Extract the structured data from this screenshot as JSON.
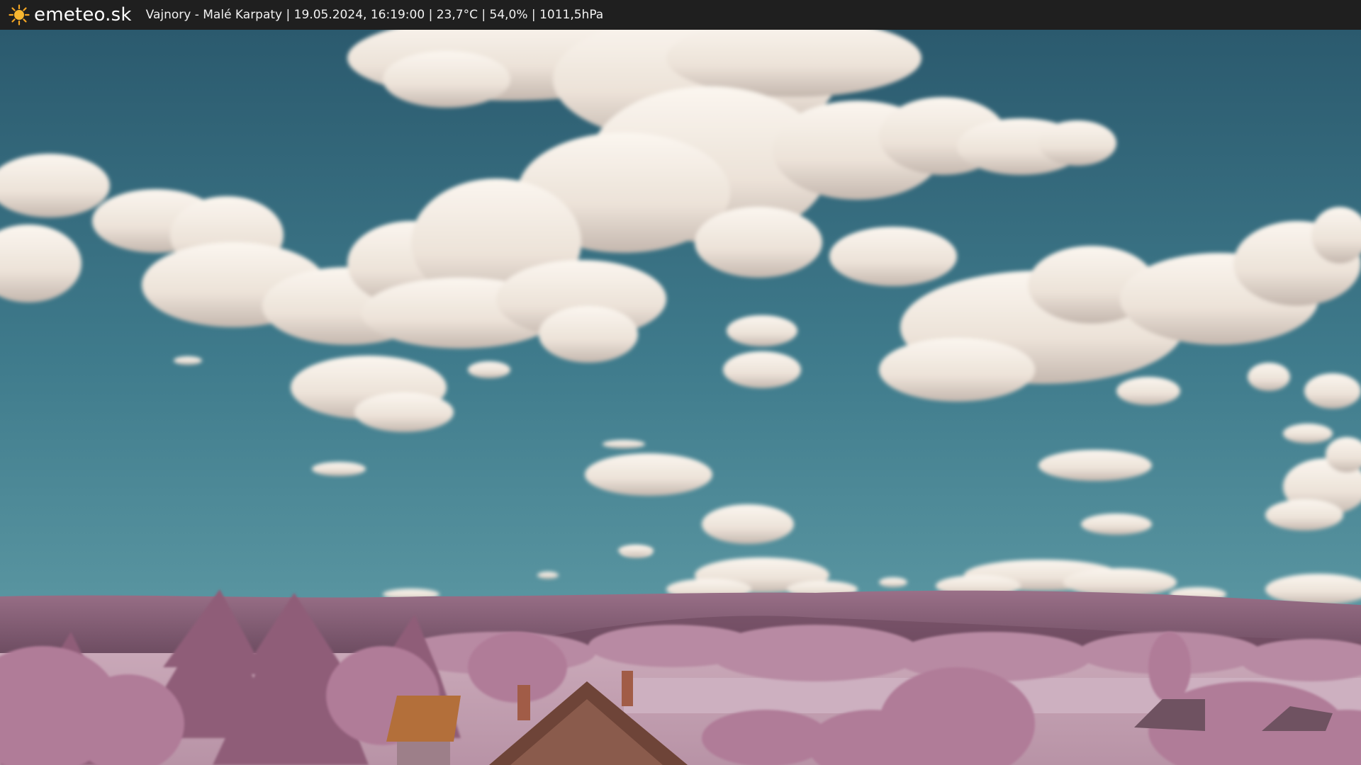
{
  "header": {
    "brand": "emeteo.sk",
    "logo_icon": "sun-icon",
    "location": "Vajnory - Malé Karpaty",
    "datetime": "19.05.2024, 16:19:00",
    "temperature": "23,7°C",
    "humidity": "54,0%",
    "pressure": "1011,5hPa",
    "separator": " | "
  },
  "image": {
    "subject": "webcam-view",
    "colors": {
      "topbar": "#1f1f1f",
      "sky_top": "#2e5f72",
      "sky_bottom": "#5c9aa6",
      "cloud": "#f2ebe2",
      "cloud_shade": "#c9bdb4",
      "hills": "#8e6a80",
      "trees": "#b37e9c",
      "field": "#c6a6b6",
      "roof": "#8a5b4c",
      "sun": "#f5a623"
    }
  }
}
